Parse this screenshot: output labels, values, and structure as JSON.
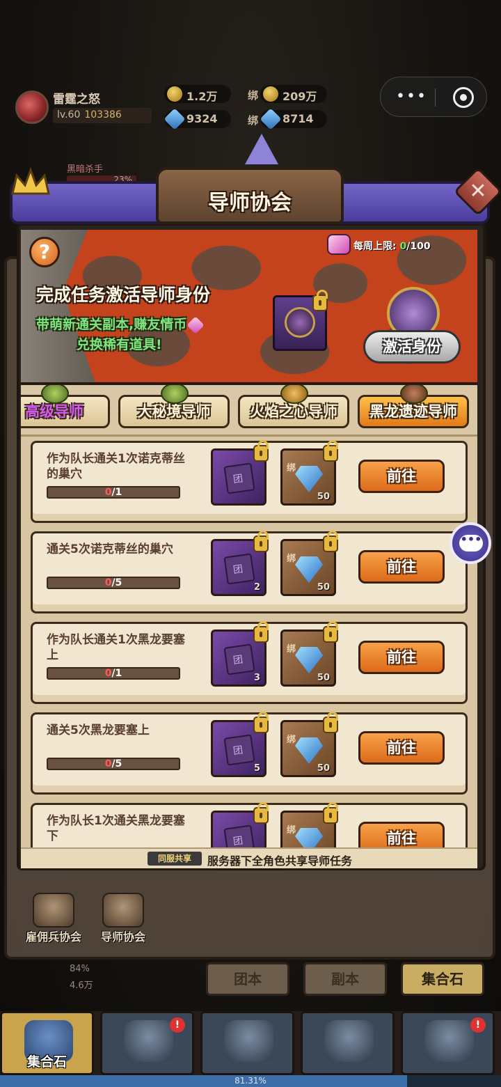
{
  "player": {
    "name": "雷霆之怒",
    "level": "lv.60",
    "power": "103386"
  },
  "resources": {
    "gold": "1.2万",
    "bound_gold": "209万",
    "gems": "9324",
    "bound_gems": "8714",
    "bound_prefix": "绑"
  },
  "enemy": {
    "name": "黑暗杀手",
    "hp": "23%"
  },
  "modal": {
    "title": "导师协会",
    "weekly_label": "每周上限:",
    "weekly_current": "0",
    "weekly_max": "/100",
    "banner_title": "完成任务激活导师身份",
    "banner_line1": "带萌新通关副本,赚友情币",
    "banner_line2": "兑换稀有道具!",
    "activate_label": "激活身份",
    "help_label": "?",
    "close_label": "✕",
    "tabs": [
      {
        "label": "高级导师",
        "selected": false
      },
      {
        "label": "大秘境导师",
        "selected": false
      },
      {
        "label": "火焰之心导师",
        "selected": false
      },
      {
        "label": "黑龙遗迹导师",
        "selected": true
      }
    ],
    "tasks": [
      {
        "desc": "作为队长通关1次诺克蒂丝的巢穴",
        "done": "0",
        "total": "/1",
        "scroll_count": "",
        "gem_count": "50",
        "go": "前往"
      },
      {
        "desc": "通关5次诺克蒂丝的巢穴",
        "done": "0",
        "total": "/5",
        "scroll_count": "2",
        "gem_count": "50",
        "go": "前往"
      },
      {
        "desc": "作为队长通关1次黑龙要塞上",
        "done": "0",
        "total": "/1",
        "scroll_count": "3",
        "gem_count": "50",
        "go": "前往"
      },
      {
        "desc": "通关5次黑龙要塞上",
        "done": "0",
        "total": "/5",
        "scroll_count": "5",
        "gem_count": "50",
        "go": "前往"
      },
      {
        "desc": "作为队长1次通关黑龙要塞下",
        "done": "",
        "total": "",
        "scroll_count": "",
        "gem_count": "",
        "go": "前往"
      }
    ],
    "bind_label": "绑",
    "share_tag": "同服共享",
    "share_text": "服务器下全角色共享导师任务"
  },
  "back_panel": {
    "tabs": [
      "团本",
      "副本",
      "集合石"
    ],
    "guild_buttons": [
      "雇佣兵协会",
      "导师协会"
    ],
    "left_stats": [
      "84%",
      "4.6万"
    ]
  },
  "bottom_nav": {
    "items": [
      {
        "label": "集合石",
        "active": true,
        "badge": ""
      },
      {
        "label": "",
        "active": false,
        "badge": "!"
      },
      {
        "label": "",
        "active": false,
        "badge": ""
      },
      {
        "label": "",
        "active": false,
        "badge": ""
      },
      {
        "label": "",
        "active": false,
        "badge": "!"
      }
    ]
  },
  "exp_progress": "81.31%",
  "colors": {
    "accent_purple": "#4a3d9c",
    "go_button": "#dd6a1a",
    "progress_red": "#ff5a5a",
    "green_text": "#7fe67f"
  }
}
